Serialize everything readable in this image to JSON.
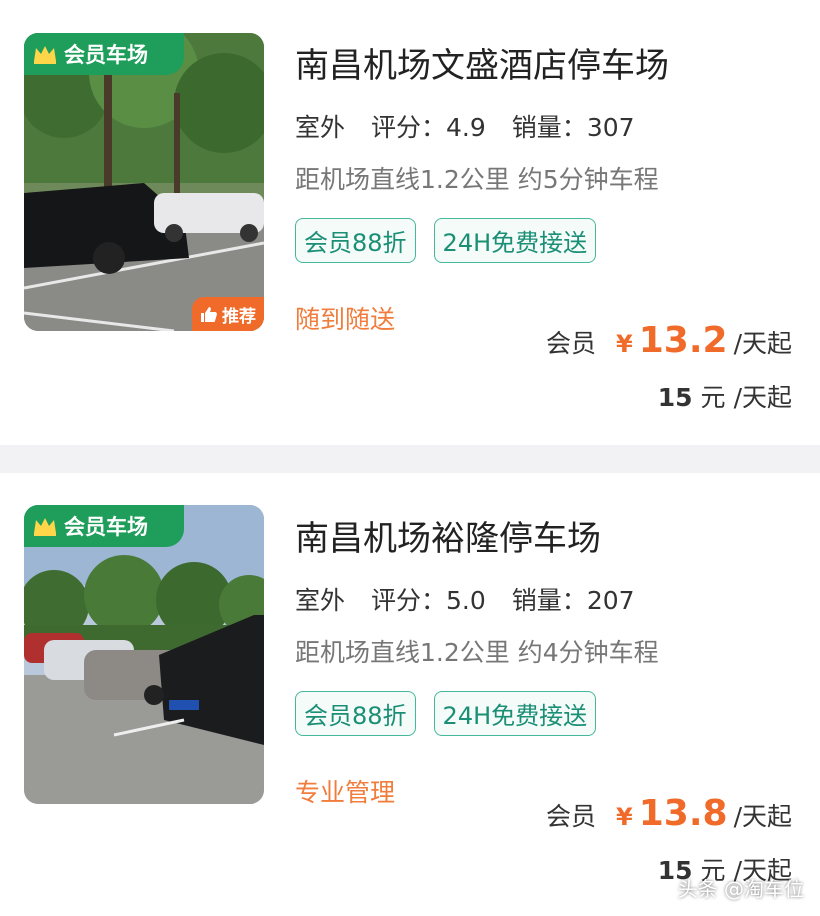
{
  "listings": [
    {
      "member_badge": "会员车场",
      "recommend_badge": "推荐",
      "title": "南昌机场文盛酒店停车场",
      "type": "室外",
      "rating_label": "评分：",
      "rating": "4.9",
      "sales_label": "销量：",
      "sales": "307",
      "distance": "距机场直线1.2公里 约5分钟车程",
      "tags": [
        "会员88折",
        "24H免费接送"
      ],
      "slogan": "随到随送",
      "member_price_label": "会员",
      "currency": "¥",
      "member_price": "13.2",
      "price_unit": "/天起",
      "base_price": "15",
      "base_currency": "元",
      "base_unit": "/天起"
    },
    {
      "member_badge": "会员车场",
      "title": "南昌机场裕隆停车场",
      "type": "室外",
      "rating_label": "评分：",
      "rating": "5.0",
      "sales_label": "销量：",
      "sales": "207",
      "distance": "距机场直线1.2公里 约4分钟车程",
      "tags": [
        "会员88折",
        "24H免费接送"
      ],
      "slogan": "专业管理",
      "member_price_label": "会员",
      "currency": "¥",
      "member_price": "13.8",
      "price_unit": "/天起",
      "base_price": "15",
      "base_currency": "元",
      "base_unit": "/天起"
    }
  ],
  "watermark": "头条 @淘车位",
  "colors": {
    "brand_green": "#1f9d5a",
    "tag_green": "#46b89a",
    "price_orange": "#f06a2a",
    "slogan_orange": "#f07d3c"
  }
}
